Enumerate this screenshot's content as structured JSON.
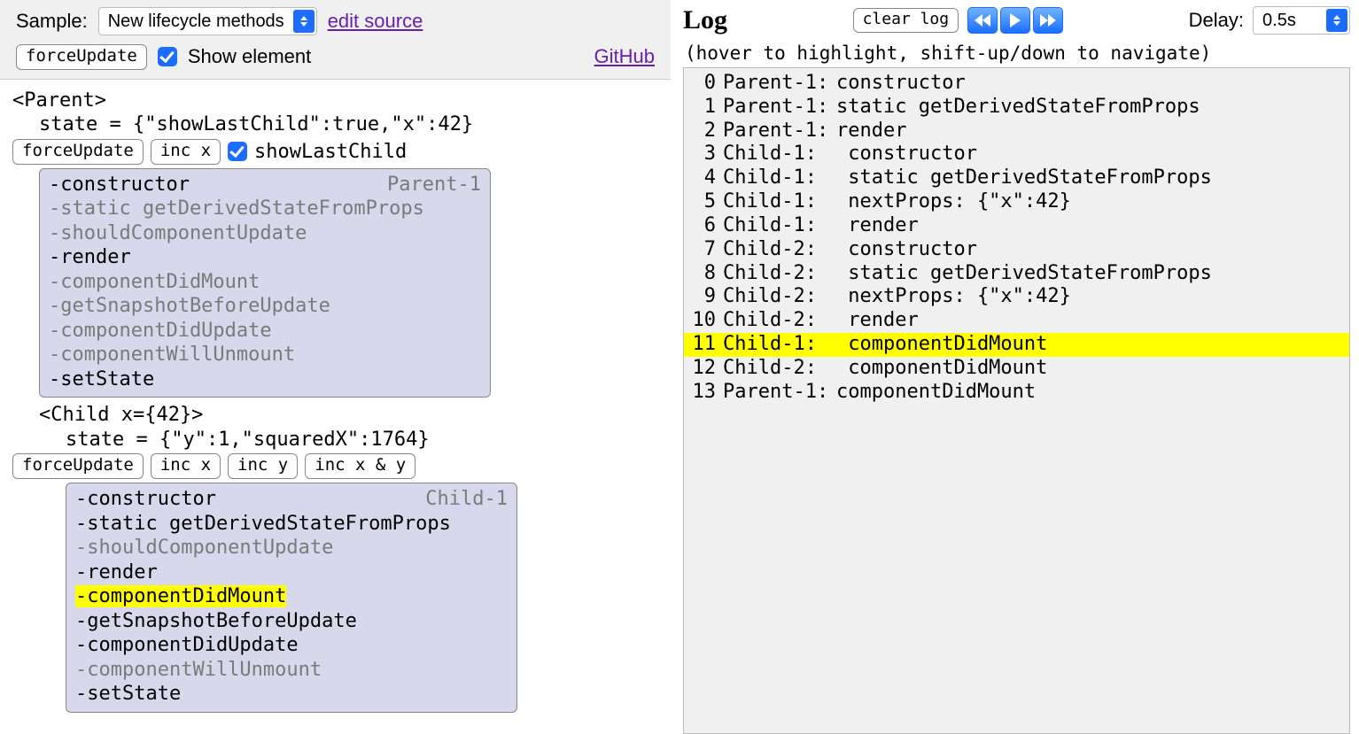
{
  "toolbar": {
    "sample_label": "Sample:",
    "sample_value": "New lifecycle methods",
    "edit_source": "edit source",
    "force_update": "forceUpdate",
    "show_element_label": "Show element",
    "github": "GitHub"
  },
  "tree": {
    "parent_tag": "<Parent>",
    "parent_state": "state = {\"showLastChild\":true,\"x\":42}",
    "parent_btns": {
      "force": "forceUpdate",
      "incx": "inc x"
    },
    "show_last_child_label": "showLastChild",
    "parent_box_tag": "Parent-1",
    "parent_lines": [
      {
        "t": "-constructor",
        "style": "on"
      },
      {
        "t": "-static getDerivedStateFromProps",
        "style": "dim"
      },
      {
        "t": "-shouldComponentUpdate",
        "style": "dim"
      },
      {
        "t": "-render",
        "style": "on"
      },
      {
        "t": "-componentDidMount",
        "style": "dim"
      },
      {
        "t": "-getSnapshotBeforeUpdate",
        "style": "dim"
      },
      {
        "t": "-componentDidUpdate",
        "style": "dim"
      },
      {
        "t": "-componentWillUnmount",
        "style": "dim"
      },
      {
        "t": "-setState",
        "style": "on"
      }
    ],
    "child_tag": "<Child x={42}>",
    "child_state": "state = {\"y\":1,\"squaredX\":1764}",
    "child_btns": {
      "force": "forceUpdate",
      "incx": "inc x",
      "incy": "inc y",
      "incxy": "inc x & y"
    },
    "child_box_tag": "Child-1",
    "child_lines": [
      {
        "t": "-constructor",
        "style": "on"
      },
      {
        "t": "-static getDerivedStateFromProps",
        "style": "on"
      },
      {
        "t": "-shouldComponentUpdate",
        "style": "dim"
      },
      {
        "t": "-render",
        "style": "on"
      },
      {
        "t": "-componentDidMount",
        "style": "hl"
      },
      {
        "t": "-getSnapshotBeforeUpdate",
        "style": "on"
      },
      {
        "t": "-componentDidUpdate",
        "style": "on"
      },
      {
        "t": "-componentWillUnmount",
        "style": "dim"
      },
      {
        "t": "-setState",
        "style": "on"
      }
    ]
  },
  "log": {
    "title": "Log",
    "clear": "clear log",
    "delay_label": "Delay:",
    "delay_value": "0.5s",
    "hint": "(hover to highlight, shift-up/down to navigate)",
    "entries": [
      {
        "n": 0,
        "who": "Parent-1:",
        "msg": "constructor",
        "hl": false
      },
      {
        "n": 1,
        "who": "Parent-1:",
        "msg": "static getDerivedStateFromProps",
        "hl": false
      },
      {
        "n": 2,
        "who": "Parent-1:",
        "msg": "render",
        "hl": false
      },
      {
        "n": 3,
        "who": "Child-1:",
        "msg": " constructor",
        "hl": false
      },
      {
        "n": 4,
        "who": "Child-1:",
        "msg": " static getDerivedStateFromProps",
        "hl": false
      },
      {
        "n": 5,
        "who": "Child-1:",
        "msg": " nextProps: {\"x\":42}",
        "hl": false
      },
      {
        "n": 6,
        "who": "Child-1:",
        "msg": " render",
        "hl": false
      },
      {
        "n": 7,
        "who": "Child-2:",
        "msg": " constructor",
        "hl": false
      },
      {
        "n": 8,
        "who": "Child-2:",
        "msg": " static getDerivedStateFromProps",
        "hl": false
      },
      {
        "n": 9,
        "who": "Child-2:",
        "msg": " nextProps: {\"x\":42}",
        "hl": false
      },
      {
        "n": 10,
        "who": "Child-2:",
        "msg": " render",
        "hl": false
      },
      {
        "n": 11,
        "who": "Child-1:",
        "msg": " componentDidMount",
        "hl": true
      },
      {
        "n": 12,
        "who": "Child-2:",
        "msg": " componentDidMount",
        "hl": false
      },
      {
        "n": 13,
        "who": "Parent-1:",
        "msg": "componentDidMount",
        "hl": false
      }
    ]
  }
}
